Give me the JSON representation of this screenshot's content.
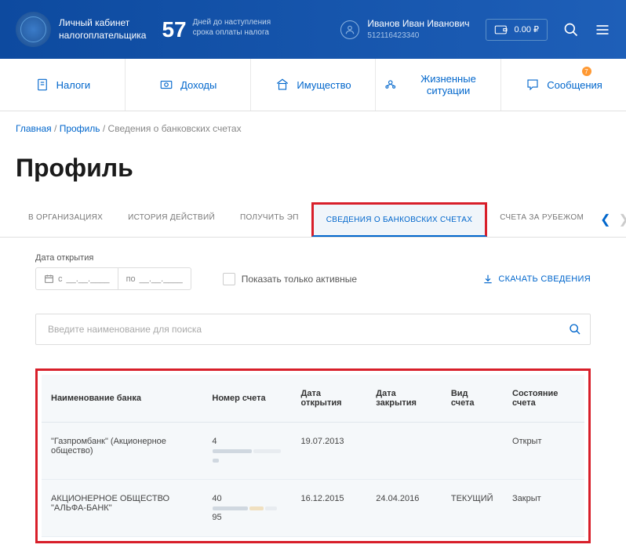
{
  "header": {
    "site_title_line1": "Личный кабинет",
    "site_title_line2": "налогоплательщика",
    "days_number": "57",
    "days_text_line1": "Дней до наступления",
    "days_text_line2": "срока оплаты налога",
    "user_name": "Иванов Иван Иванович",
    "user_id": "512116423340",
    "wallet_amount": "0.00 ₽"
  },
  "nav": {
    "items": [
      {
        "label": "Налоги"
      },
      {
        "label": "Доходы"
      },
      {
        "label": "Имущество"
      },
      {
        "label": "Жизненные ситуации"
      },
      {
        "label": "Сообщения"
      }
    ],
    "notif_count": "7"
  },
  "breadcrumbs": {
    "home": "Главная",
    "profile": "Профиль",
    "current": "Сведения о банковских счетах"
  },
  "page_title": "Профиль",
  "tabs": {
    "items": [
      {
        "label": "В ОРГАНИЗАЦИЯХ"
      },
      {
        "label": "ИСТОРИЯ ДЕЙСТВИЙ"
      },
      {
        "label": "ПОЛУЧИТЬ ЭП"
      },
      {
        "label": "СВЕДЕНИЯ О БАНКОВСКИХ СЧЕТАХ"
      },
      {
        "label": "СЧЕТА ЗА РУБЕЖОМ"
      }
    ]
  },
  "filters": {
    "date_label": "Дата открытия",
    "date_from_prefix": "с",
    "date_from_placeholder": "__.__.____",
    "date_to_prefix": "по",
    "date_to_placeholder": "__.__.____",
    "only_active_label": "Показать только активные",
    "download_label": "СКАЧАТЬ СВЕДЕНИЯ",
    "search_placeholder": "Введите наименование для поиска"
  },
  "table": {
    "headers": {
      "bank": "Наименование банка",
      "account": "Номер счета",
      "open_date": "Дата открытия",
      "close_date": "Дата закрытия",
      "type": "Вид счета",
      "status": "Состояние счета"
    },
    "rows": [
      {
        "bank": "\"Газпромбанк\" (Акционерное общество)",
        "account_prefix": "4",
        "account_suffix": "",
        "open_date": "19.07.2013",
        "close_date": "",
        "type": "",
        "status": "Открыт"
      },
      {
        "bank": "АКЦИОНЕРНОЕ ОБЩЕСТВО \"АЛЬФА-БАНК\"",
        "account_prefix": "40",
        "account_suffix": "95",
        "open_date": "16.12.2015",
        "close_date": "24.04.2016",
        "type": "ТЕКУЩИЙ",
        "status": "Закрыт"
      }
    ]
  }
}
